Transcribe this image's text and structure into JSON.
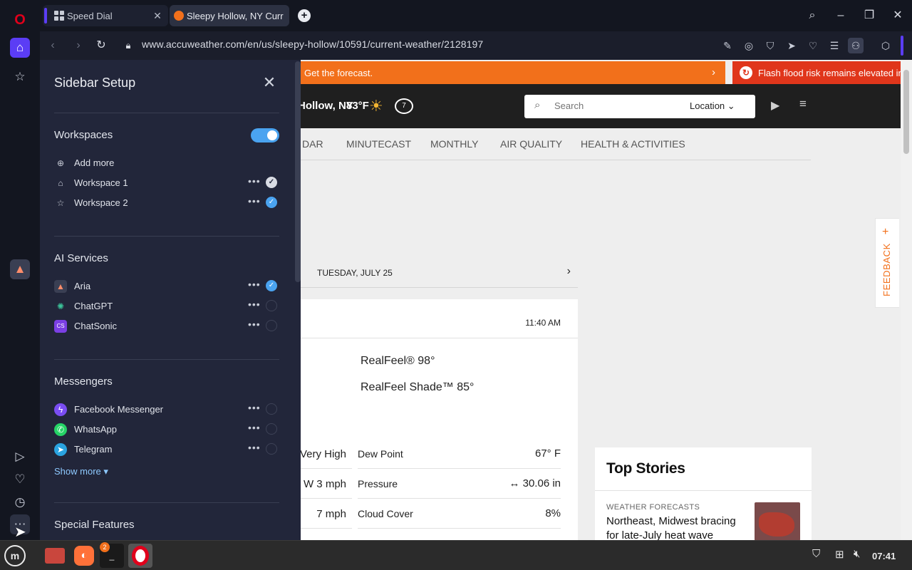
{
  "browser": {
    "tabs": [
      {
        "label": "Speed Dial"
      },
      {
        "label": "Sleepy Hollow, NY Curr"
      }
    ],
    "url": "www.accuweather.com/en/us/sleepy-hollow/10591/current-weather/2128197"
  },
  "setup_panel": {
    "title": "Sidebar Setup",
    "workspaces": {
      "title": "Workspaces",
      "enabled": true,
      "add_more": "Add more",
      "items": [
        {
          "label": "Workspace 1",
          "checked": true
        },
        {
          "label": "Workspace 2",
          "checked": true
        }
      ]
    },
    "ai_services": {
      "title": "AI Services",
      "items": [
        {
          "label": "Aria",
          "checked": true
        },
        {
          "label": "ChatGPT",
          "checked": false
        },
        {
          "label": "ChatSonic",
          "checked": false
        }
      ]
    },
    "messengers": {
      "title": "Messengers",
      "items": [
        {
          "label": "Facebook Messenger",
          "checked": false
        },
        {
          "label": "WhatsApp",
          "checked": false
        },
        {
          "label": "Telegram",
          "checked": false
        }
      ],
      "show_more": "Show more"
    },
    "special_features": {
      "title": "Special Features"
    }
  },
  "page": {
    "banner": "Get the forecast.",
    "alert": "Flash flood risk remains elevated in",
    "header": {
      "location": "Hollow, NY",
      "temp": "83°F",
      "search_placeholder": "Search",
      "location_button": "Location"
    },
    "nav": [
      "DAR",
      "MINUTECAST",
      "MONTHLY",
      "AIR QUALITY",
      "HEALTH & ACTIVITIES"
    ],
    "date": "TUESDAY, JULY 25",
    "current": {
      "time": "11:40 AM",
      "realfeel": "RealFeel® 98°",
      "realfeel_shade": "RealFeel Shade™ 85°",
      "left_values": [
        "Very High",
        "W 3 mph",
        "7 mph"
      ],
      "metrics": [
        {
          "label": "Dew Point",
          "value": "67° F"
        },
        {
          "label": "Pressure",
          "value": "↔ 30.06 in"
        },
        {
          "label": "Cloud Cover",
          "value": "8%"
        }
      ]
    },
    "top_stories": {
      "title": "Top Stories",
      "category": "WEATHER FORECASTS",
      "headline": "Northeast, Midwest bracing for late-July heat wave"
    },
    "feedback": "FEEDBACK"
  },
  "taskbar": {
    "clock": "07:41",
    "terminal_badge": "2"
  },
  "colors": {
    "panel_bg": "#22263a",
    "accent_blue": "#4aa3f0",
    "banner_orange": "#f2701b",
    "alert_red": "#e0361b",
    "opera_red": "#e0001b",
    "workspace_purple": "#5b3df5"
  }
}
